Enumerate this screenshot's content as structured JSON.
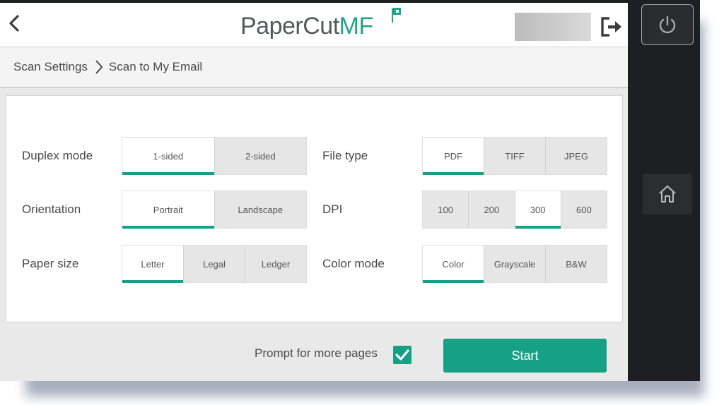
{
  "header": {
    "logo_main": "PaperCut",
    "logo_suffix": "MF"
  },
  "breadcrumb": {
    "parent": "Scan Settings",
    "current": "Scan to My Email"
  },
  "settings": {
    "duplex": {
      "label": "Duplex mode",
      "options": [
        "1-sided",
        "2-sided"
      ],
      "selected": "1-sided"
    },
    "orientation": {
      "label": "Orientation",
      "options": [
        "Portrait",
        "Landscape"
      ],
      "selected": "Portrait"
    },
    "paper_size": {
      "label": "Paper size",
      "options": [
        "Letter",
        "Legal",
        "Ledger"
      ],
      "selected": "Letter"
    },
    "file_type": {
      "label": "File type",
      "options": [
        "PDF",
        "TIFF",
        "JPEG"
      ],
      "selected": "PDF"
    },
    "dpi": {
      "label": "DPI",
      "options": [
        "100",
        "200",
        "300",
        "600"
      ],
      "selected": "300"
    },
    "color_mode": {
      "label": "Color mode",
      "options": [
        "Color",
        "Grayscale",
        "B&W"
      ],
      "selected": "Color"
    }
  },
  "footer": {
    "prompt_label": "Prompt for more pages",
    "prompt_checked": true,
    "start_label": "Start"
  },
  "colors": {
    "accent": "#16a085",
    "logo_gray": "#555a5e",
    "device_bezel": "#1d1f22"
  },
  "icons": {
    "back": "chevron-left-icon",
    "logout": "logout-icon",
    "power": "power-icon",
    "home": "home-icon",
    "check": "check-icon"
  }
}
